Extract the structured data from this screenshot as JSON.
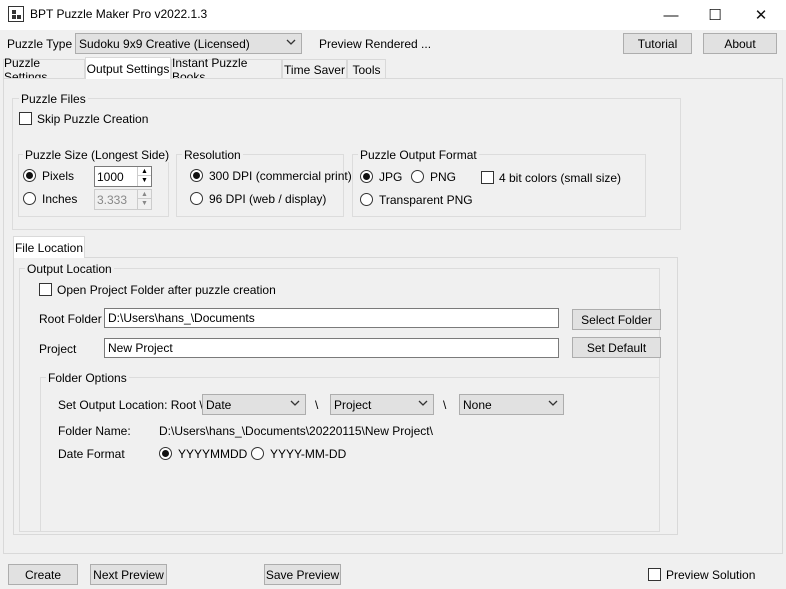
{
  "window": {
    "title": "BPT Puzzle Maker Pro v2022.1.3",
    "minimize": "—",
    "maximize": "☐",
    "close": "✕"
  },
  "toolbar": {
    "puzzle_type_label": "Puzzle Type",
    "puzzle_type_value": "Sudoku 9x9 Creative (Licensed)",
    "preview_status": "Preview Rendered ...",
    "tutorial": "Tutorial",
    "about": "About"
  },
  "tabs": [
    {
      "label": "Puzzle Settings",
      "active": false
    },
    {
      "label": "Output Settings",
      "active": true
    },
    {
      "label": "Instant Puzzle Books",
      "active": false
    },
    {
      "label": "Time Saver",
      "active": false
    },
    {
      "label": "Tools",
      "active": false
    }
  ],
  "puzzle_files": {
    "title": "Puzzle Files",
    "skip_creation": "Skip Puzzle Creation",
    "skip_checked": false
  },
  "puzzle_size": {
    "title": "Puzzle Size (Longest Side)",
    "pixels_label": "Pixels",
    "pixels_value": "1000",
    "pixels_selected": true,
    "inches_label": "Inches",
    "inches_value": "3.333",
    "inches_selected": false
  },
  "resolution": {
    "title": "Resolution",
    "opt_300": "300 DPI (commercial print)",
    "opt_96": "96  DPI (web / display)",
    "selected": "300"
  },
  "output_format": {
    "title": "Puzzle Output Format",
    "jpg": "JPG",
    "png": "PNG",
    "transparent_png": "Transparent PNG",
    "four_bit": "4 bit colors (small size)",
    "selected": "JPG",
    "four_bit_checked": false
  },
  "file_location_tab": "File Location",
  "output_location": {
    "title": "Output Location",
    "open_folder_label": "Open Project Folder after puzzle creation",
    "open_folder_checked": false,
    "root_folder_label": "Root Folder",
    "root_folder_value": "D:\\Users\\hans_\\Documents",
    "select_folder": "Select Folder",
    "project_label": "Project",
    "project_value": "New Project",
    "set_default": "Set Default"
  },
  "folder_options": {
    "title": "Folder Options",
    "set_output_label": "Set Output Location: Root \\",
    "combo1": "Date",
    "sep1": "\\",
    "combo2": "Project",
    "sep2": "\\",
    "combo3": "None",
    "folder_name_label": "Folder Name:",
    "folder_name_value": "D:\\Users\\hans_\\Documents\\20220115\\New Project\\",
    "date_format_label": "Date Format",
    "date_opt1": "YYYYMMDD",
    "date_opt2": "YYYY-MM-DD",
    "date_selected": "YYYYMMDD"
  },
  "bottom": {
    "create": "Create",
    "next_preview": "Next Preview",
    "save_preview": "Save Preview",
    "preview_solution": "Preview Solution",
    "preview_solution_checked": false
  },
  "icons": {
    "app": "puzzle-grid-icon",
    "dropdown": "chevron-down-icon"
  }
}
